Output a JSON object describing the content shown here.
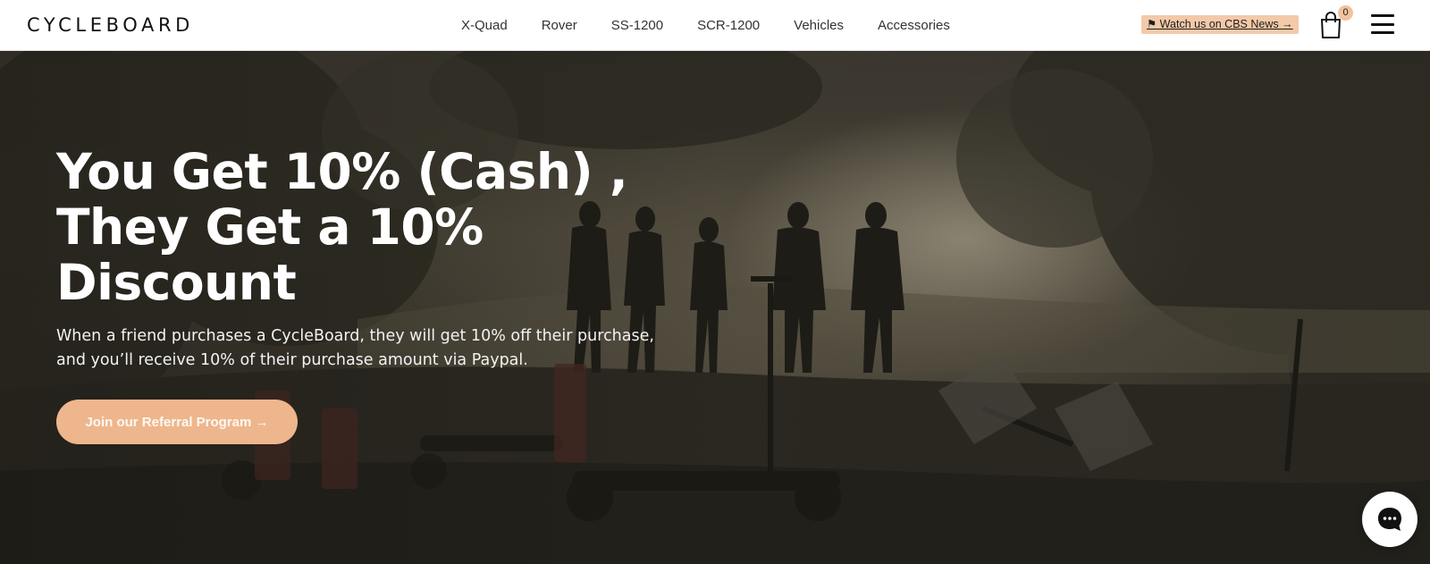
{
  "header": {
    "logo_text": "CYCLEBOARD",
    "nav": [
      "X-Quad",
      "Rover",
      "SS-1200",
      "SCR-1200",
      "Vehicles",
      "Accessories"
    ],
    "cbs_link": "⚑ Watch us on CBS News →",
    "cart_count": "0",
    "icons": {
      "cart": "shopping-bag-icon",
      "menu": "hamburger-menu-icon"
    }
  },
  "hero": {
    "title_lines": [
      "You Get 10% (Cash) ,",
      "They Get a 10%",
      "Discount"
    ],
    "description_lines": [
      "When a friend purchases a CycleBoard, they will get 10% off their purchase,",
      "and you’ll receive 10% of their purchase amount via Paypal."
    ],
    "cta_label": "Join our Referral Program →"
  },
  "chat": {
    "icon": "chat-bubble-icon"
  },
  "colors": {
    "accent": "#eeb68d",
    "cbs_badge": "#f3c9a8",
    "header_bg": "#ffffff",
    "text_dark": "#111111"
  }
}
